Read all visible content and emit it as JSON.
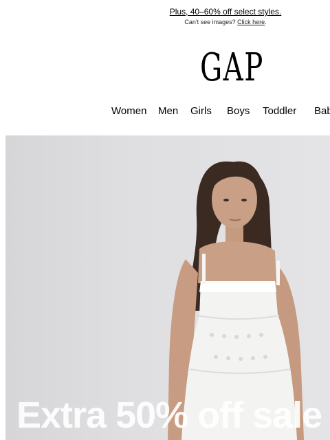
{
  "header": {
    "promo_link": "Plus, 40–60% off select styles.",
    "cant_see_text": "Can't see images?",
    "click_here": "Click here",
    "cant_see_suffix": "."
  },
  "brand": {
    "logo_text": "GAP"
  },
  "nav": {
    "items": [
      {
        "label": "Women"
      },
      {
        "label": "Men"
      },
      {
        "label": "Girls"
      },
      {
        "label": "Boys"
      },
      {
        "label": "Toddler"
      },
      {
        "label": "Baby"
      }
    ]
  },
  "hero": {
    "headline": "Extra 50% off sale"
  }
}
